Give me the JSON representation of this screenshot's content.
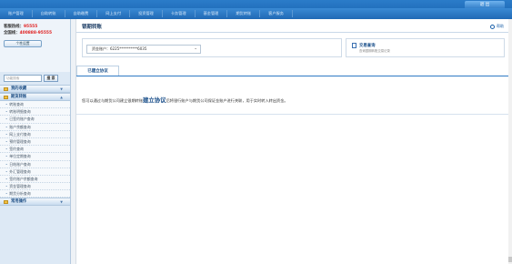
{
  "topnav": {
    "items": [
      "账户管理",
      "自助转账",
      "自助缴费",
      "网上支付",
      "投资管理",
      "卡务管理",
      "基金管理",
      "期货转账",
      "客户服务"
    ],
    "logout_label": "退  出"
  },
  "sidebar": {
    "user_label": "客服热线：",
    "user_value": "95555",
    "hotline_label": "全国线：",
    "hotline_value": "400888-95555",
    "user_button": "个性设置",
    "search_placeholder": "功能搜索",
    "search_button": "搜 索",
    "sections": [
      {
        "label": "我的收藏"
      },
      {
        "label": "期货转账"
      },
      {
        "label": "常用操作"
      }
    ],
    "subitems": [
      "转账查询",
      "转账明细查询",
      "已签约账户查询",
      "账户余额查询",
      "网上支付查询",
      "预约管理查询",
      "签约查询",
      "单位定期查询",
      "日结账户查询",
      "外汇管理查询",
      "签约账户余额查询",
      "资金管理查询",
      "期货分析查询"
    ]
  },
  "main": {
    "title": "银期转账",
    "help": "帮助",
    "account_select": "资金账户：6225**********6035",
    "side_card_title": "交易查询",
    "side_card_sub": "查询银期转账交易记录",
    "tab_label": "已建立协议",
    "para_before": "您可以通过与期货公司建立银期转账",
    "para_big": "建立协议",
    "para_after": "后将银行账户与期货公司保证金账户进行关联，用于实时转入转出资金。"
  },
  "colors": {
    "brand": "#1762ae",
    "accent": "#e02020"
  }
}
